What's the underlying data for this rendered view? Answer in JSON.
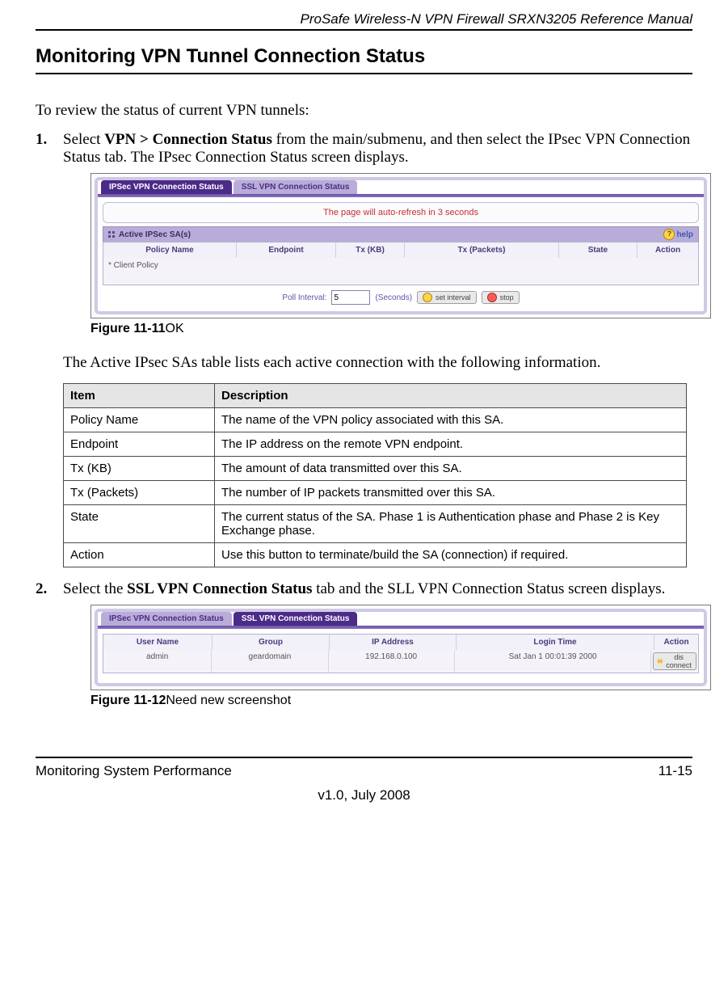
{
  "header": {
    "title": "ProSafe Wireless-N VPN Firewall SRXN3205 Reference Manual"
  },
  "section": {
    "title": "Monitoring VPN Tunnel Connection Status"
  },
  "intro": "To review the status of current VPN tunnels:",
  "step1": {
    "pre": "Select ",
    "bold": "VPN > Connection Status",
    "post": " from the main/submenu, and then select the IPsec VPN Connection Status tab. The IPsec Connection Status screen displays."
  },
  "shot1": {
    "tabs": {
      "active": "IPSec VPN Connection Status",
      "inactive": "SSL VPN Connection Status"
    },
    "refresh": "The page will auto-refresh in 3 seconds",
    "panel_title": "Active IPSec SA(s)",
    "help": "help",
    "cols": {
      "policy": "Policy Name",
      "endpoint": "Endpoint",
      "txkb": "Tx (KB)",
      "txp": "Tx (Packets)",
      "state": "State",
      "action": "Action"
    },
    "row": "* Client Policy",
    "poll": {
      "label": "Poll Interval:",
      "value": "5",
      "unit": "(Seconds)",
      "set": "set interval",
      "stop": "stop"
    }
  },
  "fig1": {
    "num": "Figure 11-11",
    "suffix": "OK"
  },
  "midtext": "The Active IPsec SAs table lists each active connection with the following information.",
  "sa_table": {
    "head": {
      "item": "Item",
      "desc": "Description"
    },
    "rows": [
      {
        "item": "Policy Name",
        "desc": "The name of the VPN policy associated with this SA."
      },
      {
        "item": "Endpoint",
        "desc": "The IP address on the remote VPN endpoint."
      },
      {
        "item": "Tx (KB)",
        "desc": "The amount of data transmitted over this SA."
      },
      {
        "item": "Tx (Packets)",
        "desc": "The number of IP packets transmitted over this SA."
      },
      {
        "item": "State",
        "desc": "The current status of the SA. Phase 1 is Authentication phase and Phase 2 is Key Exchange phase."
      },
      {
        "item": "Action",
        "desc": "Use this button to terminate/build the SA (connection) if required."
      }
    ]
  },
  "step2": {
    "pre": "Select the ",
    "bold": "SSL VPN Connection Status",
    "post": " tab and the SLL VPN Connection Status screen displays."
  },
  "shot2": {
    "tabs": {
      "inactive": "IPSec VPN Connection Status",
      "active": "SSL VPN Connection Status"
    },
    "cols": {
      "user": "User Name",
      "group": "Group",
      "ip": "IP Address",
      "login": "Login Time",
      "action": "Action"
    },
    "row": {
      "user": "admin",
      "group": "geardomain",
      "ip": "192.168.0.100",
      "login": "Sat Jan 1 00:01:39 2000",
      "disconnect": "dis connect"
    }
  },
  "fig2": {
    "num": "Figure 11-12",
    "suffix": "Need new screenshot"
  },
  "footer": {
    "left": "Monitoring System Performance",
    "right": "11-15",
    "center": "v1.0, July 2008"
  }
}
